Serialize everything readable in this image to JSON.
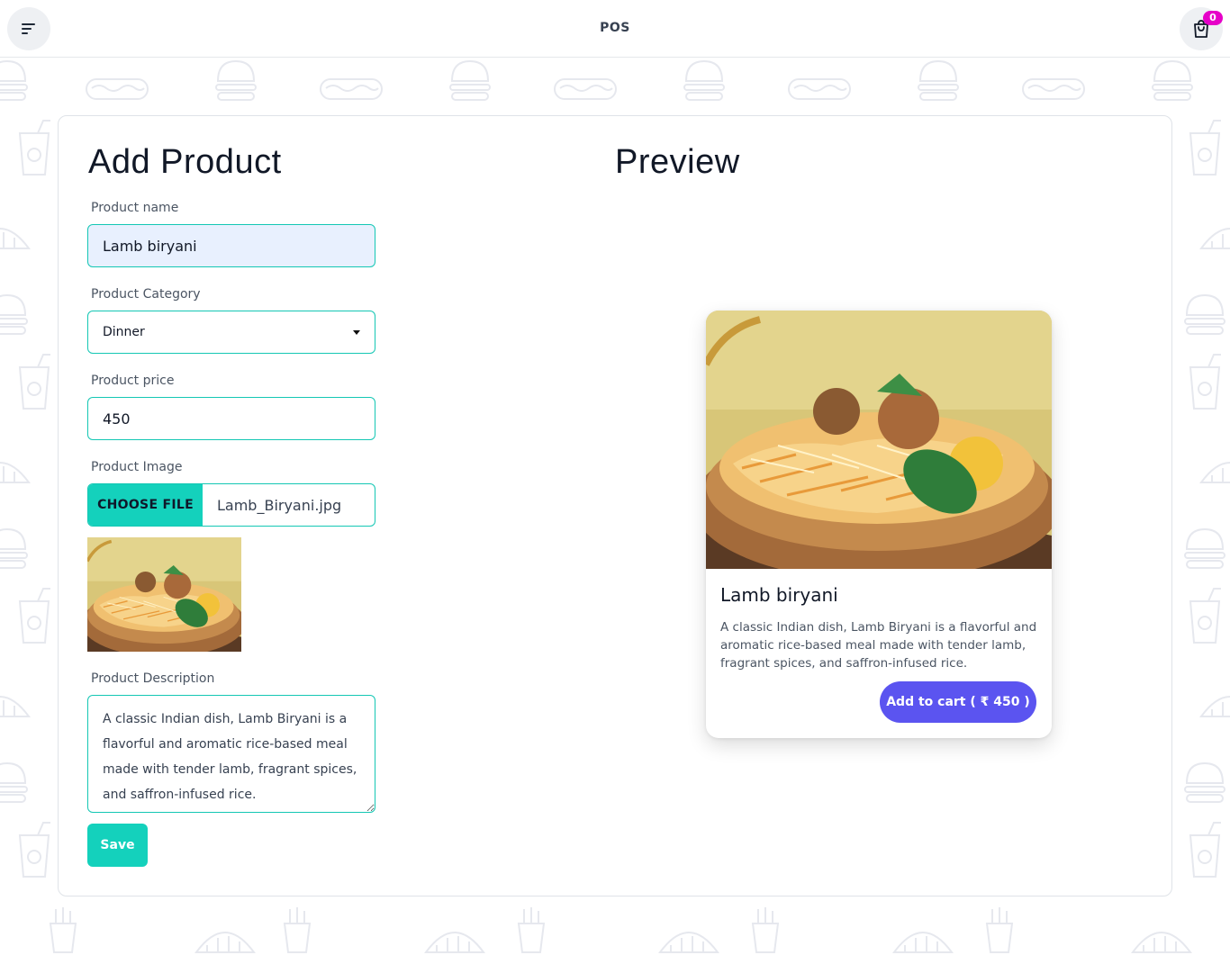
{
  "app": {
    "title": "POS"
  },
  "header": {
    "cart_count": "0"
  },
  "form": {
    "title": "Add Product",
    "name_label": "Product name",
    "name_value": "Lamb biryani",
    "category_label": "Product Category",
    "category_value": "Dinner",
    "price_label": "Product price",
    "price_value": "450",
    "image_label": "Product Image",
    "choose_file_label": "CHOOSE FILE",
    "file_name": "Lamb_Biryani.jpg",
    "description_label": "Product Description",
    "description_value": "A classic Indian dish, Lamb Biryani is a flavorful and aromatic rice-based meal made with tender lamb, fragrant spices, and saffron-infused rice.",
    "save_label": "Save"
  },
  "preview": {
    "title": "Preview",
    "name": "Lamb biryani",
    "description": "A classic Indian dish, Lamb Biryani is a flavorful and aromatic rice-based meal made with tender lamb, fragrant spices, and saffron-infused rice.",
    "add_to_cart_label": "Add to cart  ( ₹ 450 )"
  },
  "colors": {
    "accent": "#14d1bc",
    "purple": "#5b54f0",
    "badge": "#e600c8"
  },
  "icons": [
    "menu-icon",
    "shopping-bag-icon",
    "caret-down-icon"
  ]
}
